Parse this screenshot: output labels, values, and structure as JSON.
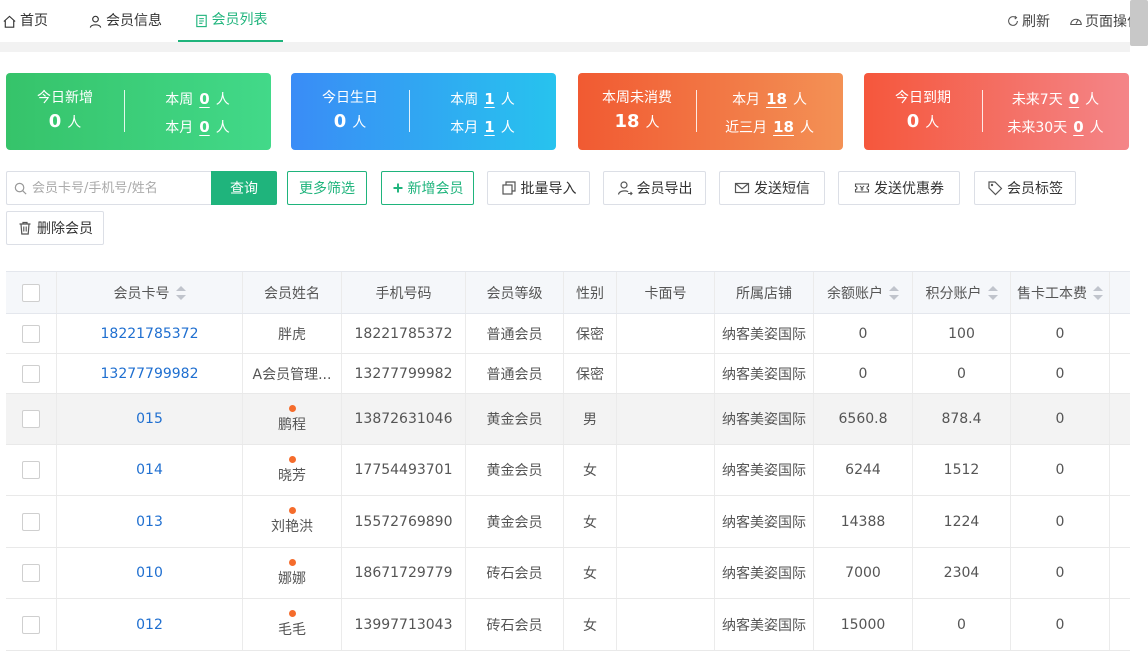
{
  "tabs": {
    "home": "首页",
    "member_info": "会员信息",
    "member_list": "会员列表"
  },
  "top_actions": {
    "refresh": "刷新",
    "page_ops": "页面操作"
  },
  "colors": {
    "accent": "#1fb47c",
    "link": "#1f6fd0",
    "dot": "#f56c2c"
  },
  "cards": [
    {
      "title": "今日新增",
      "value": "0",
      "unit": "人",
      "r1_label": "本周",
      "r1_value": "0",
      "r1_unit": "人",
      "r2_label": "本月",
      "r2_value": "0",
      "r2_unit": "人"
    },
    {
      "title": "今日生日",
      "value": "0",
      "unit": "人",
      "r1_label": "本周",
      "r1_value": "1",
      "r1_unit": "人",
      "r2_label": "本月",
      "r2_value": "1",
      "r2_unit": "人"
    },
    {
      "title": "本周未消费",
      "value": "18",
      "unit": "人",
      "r1_label": "本月",
      "r1_value": "18",
      "r1_unit": "人",
      "r2_label": "近三月",
      "r2_value": "18",
      "r2_unit": "人"
    },
    {
      "title": "今日到期",
      "value": "0",
      "unit": "人",
      "r1_label": "未来7天",
      "r1_value": "0",
      "r1_unit": "人",
      "r2_label": "未来30天",
      "r2_value": "0",
      "r2_unit": "人"
    }
  ],
  "search": {
    "placeholder": "会员卡号/手机号/姓名",
    "query_label": "查询"
  },
  "toolbar": {
    "more_filter": "更多筛选",
    "add_member": "新增会员",
    "batch_import": "批量导入",
    "export": "会员导出",
    "send_sms": "发送短信",
    "send_coupon": "发送优惠券",
    "tags": "会员标签",
    "delete": "删除会员"
  },
  "table": {
    "headers": {
      "card_no": "会员卡号",
      "name": "会员姓名",
      "phone": "手机号码",
      "level": "会员等级",
      "gender": "性别",
      "face_no": "卡面号",
      "store": "所属店铺",
      "balance": "余额账户",
      "points": "积分账户",
      "fee": "售卡工本费"
    },
    "rows": [
      {
        "card_no": "18221785372",
        "name": "胖虎",
        "phone": "18221785372",
        "level": "普通会员",
        "gender": "保密",
        "face_no": "",
        "store": "纳客美姿国际",
        "balance": "0",
        "points": "100",
        "fee": "0",
        "dot": false
      },
      {
        "card_no": "13277799982",
        "name": "A会员管理...",
        "phone": "13277799982",
        "level": "普通会员",
        "gender": "保密",
        "face_no": "",
        "store": "纳客美姿国际",
        "balance": "0",
        "points": "0",
        "fee": "0",
        "dot": false
      },
      {
        "card_no": "015",
        "name": "鹏程",
        "phone": "13872631046",
        "level": "黄金会员",
        "gender": "男",
        "face_no": "",
        "store": "纳客美姿国际",
        "balance": "6560.8",
        "points": "878.4",
        "fee": "0",
        "dot": true
      },
      {
        "card_no": "014",
        "name": "晓芳",
        "phone": "17754493701",
        "level": "黄金会员",
        "gender": "女",
        "face_no": "",
        "store": "纳客美姿国际",
        "balance": "6244",
        "points": "1512",
        "fee": "0",
        "dot": true
      },
      {
        "card_no": "013",
        "name": "刘艳洪",
        "phone": "15572769890",
        "level": "黄金会员",
        "gender": "女",
        "face_no": "",
        "store": "纳客美姿国际",
        "balance": "14388",
        "points": "1224",
        "fee": "0",
        "dot": true
      },
      {
        "card_no": "010",
        "name": "娜娜",
        "phone": "18671729779",
        "level": "砖石会员",
        "gender": "女",
        "face_no": "",
        "store": "纳客美姿国际",
        "balance": "7000",
        "points": "2304",
        "fee": "0",
        "dot": true
      },
      {
        "card_no": "012",
        "name": "毛毛",
        "phone": "13997713043",
        "level": "砖石会员",
        "gender": "女",
        "face_no": "",
        "store": "纳客美姿国际",
        "balance": "15000",
        "points": "0",
        "fee": "0",
        "dot": true
      }
    ]
  }
}
